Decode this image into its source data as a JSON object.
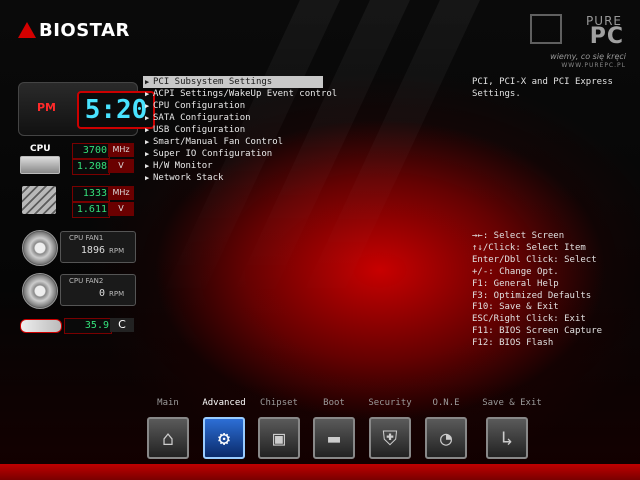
{
  "brand": "BIOSTAR",
  "watermark": {
    "pure": "PURE",
    "pc": "PC",
    "slogan": "wiemy, co się kręci",
    "url": "WWW.PUREPC.PL"
  },
  "clock": {
    "ampm": "PM",
    "time": "5:20"
  },
  "cpu": {
    "label": "CPU",
    "freq": "3700",
    "freq_unit": "MHz",
    "volt": "1.208",
    "volt_unit": "V"
  },
  "memory": {
    "freq": "1333",
    "freq_unit": "MHz",
    "volt": "1.611",
    "volt_unit": "V"
  },
  "fans": [
    {
      "label": "CPU FAN1",
      "value": "1896",
      "unit": "RPM"
    },
    {
      "label": "CPU FAN2",
      "value": "0",
      "unit": "RPM"
    }
  ],
  "temperature": {
    "value": "35.9",
    "unit": "C"
  },
  "menu": [
    "PCI Subsystem Settings",
    "ACPI Settings/WakeUp Event control",
    "CPU Configuration",
    "SATA Configuration",
    "USB Configuration",
    "Smart/Manual Fan Control",
    "Super IO Configuration",
    "H/W Monitor",
    "Network Stack"
  ],
  "selected_index": 0,
  "help_text": "PCI, PCI-X and PCI Express Settings.",
  "keys": [
    "→←: Select Screen",
    "↑↓/Click: Select Item",
    "Enter/Dbl Click: Select",
    "+/-: Change Opt.",
    "F1: General Help",
    "F3: Optimized Defaults",
    "F10: Save & Exit",
    "ESC/Right Click: Exit",
    "F11: BIOS Screen Capture",
    "F12: BIOS Flash"
  ],
  "tabs": [
    {
      "label": "Main",
      "icon": "home-icon",
      "glyph": "⌂"
    },
    {
      "label": "Advanced",
      "icon": "advanced-icon",
      "glyph": "⚙"
    },
    {
      "label": "Chipset",
      "icon": "chipset-icon",
      "glyph": "▣"
    },
    {
      "label": "Boot",
      "icon": "boot-icon",
      "glyph": "▬"
    },
    {
      "label": "Security",
      "icon": "security-icon",
      "glyph": "⛨"
    },
    {
      "label": "O.N.E",
      "icon": "one-icon",
      "glyph": "◔"
    },
    {
      "label": "Save & Exit",
      "icon": "save-exit-icon",
      "glyph": "↳"
    }
  ],
  "active_tab": 1,
  "colors": {
    "accent": "#c00000",
    "readout": "#34e07a",
    "clock_digits": "#49e3ff",
    "selected_bg": "#c8c8c8"
  }
}
